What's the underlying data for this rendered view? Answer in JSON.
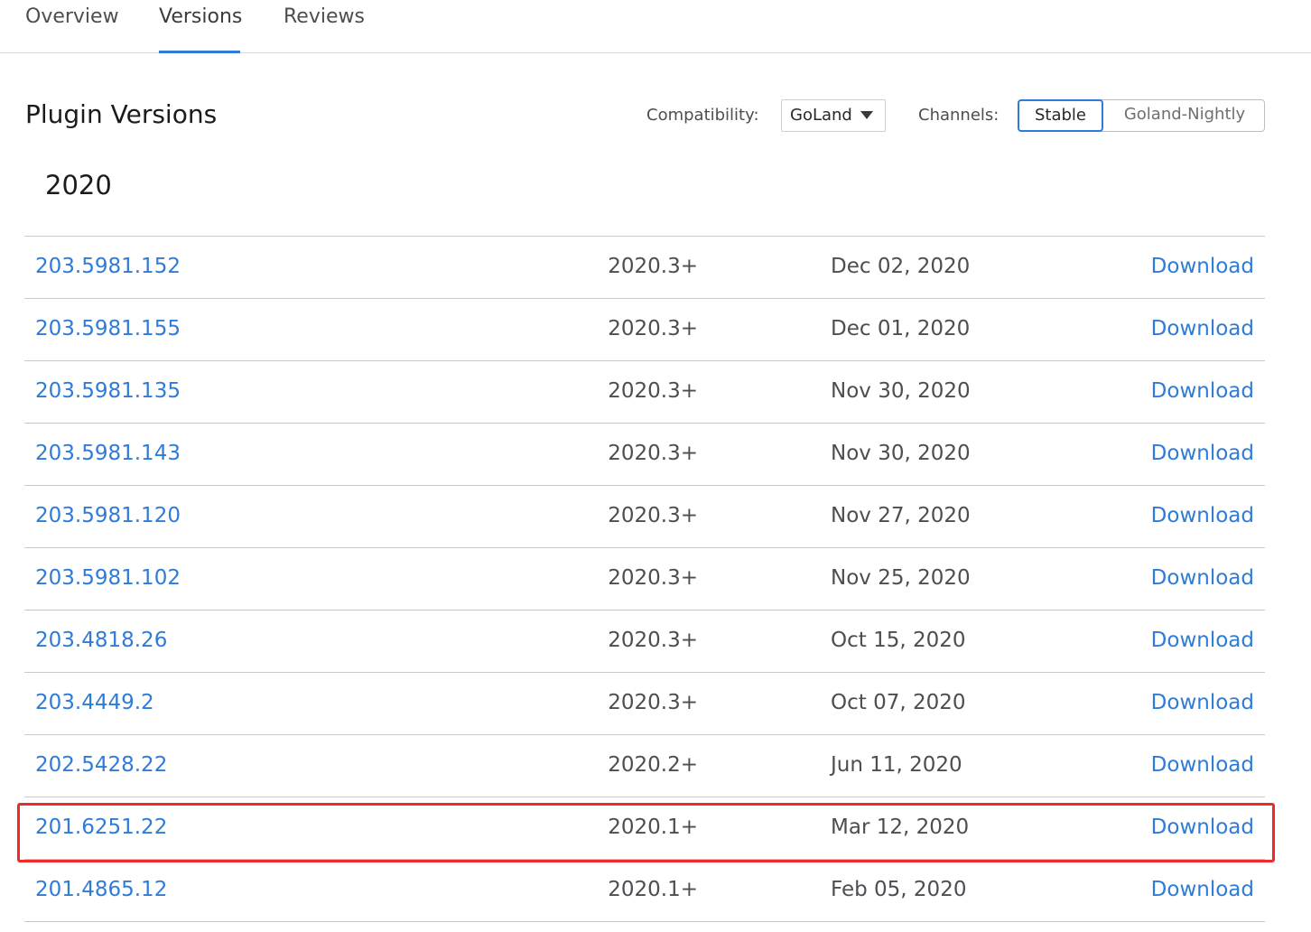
{
  "tabs": [
    {
      "label": "Overview",
      "active": false
    },
    {
      "label": "Versions",
      "active": true
    },
    {
      "label": "Reviews",
      "active": false
    }
  ],
  "header": {
    "title": "Plugin Versions",
    "compatibility_label": "Compatibility:",
    "compatibility_value": "GoLand",
    "channels_label": "Channels:",
    "channels": [
      {
        "label": "Stable",
        "selected": true
      },
      {
        "label": "Goland-Nightly",
        "selected": false
      }
    ]
  },
  "accent_color": "#2e7bd8",
  "highlight_color": "#ee2a2a",
  "year_group": {
    "year": "2020",
    "rows": [
      {
        "version": "203.5981.152",
        "compat": "2020.3+",
        "date": "Dec 02, 2020",
        "action": "Download"
      },
      {
        "version": "203.5981.155",
        "compat": "2020.3+",
        "date": "Dec 01, 2020",
        "action": "Download"
      },
      {
        "version": "203.5981.135",
        "compat": "2020.3+",
        "date": "Nov 30, 2020",
        "action": "Download"
      },
      {
        "version": "203.5981.143",
        "compat": "2020.3+",
        "date": "Nov 30, 2020",
        "action": "Download"
      },
      {
        "version": "203.5981.120",
        "compat": "2020.3+",
        "date": "Nov 27, 2020",
        "action": "Download"
      },
      {
        "version": "203.5981.102",
        "compat": "2020.3+",
        "date": "Nov 25, 2020",
        "action": "Download"
      },
      {
        "version": "203.4818.26",
        "compat": "2020.3+",
        "date": "Oct 15, 2020",
        "action": "Download"
      },
      {
        "version": "203.4449.2",
        "compat": "2020.3+",
        "date": "Oct 07, 2020",
        "action": "Download"
      },
      {
        "version": "202.5428.22",
        "compat": "2020.2+",
        "date": "Jun 11, 2020",
        "action": "Download"
      },
      {
        "version": "201.6251.22",
        "compat": "2020.1+",
        "date": "Mar 12, 2020",
        "action": "Download",
        "highlighted": true
      },
      {
        "version": "201.4865.12",
        "compat": "2020.1+",
        "date": "Feb 05, 2020",
        "action": "Download"
      }
    ]
  }
}
